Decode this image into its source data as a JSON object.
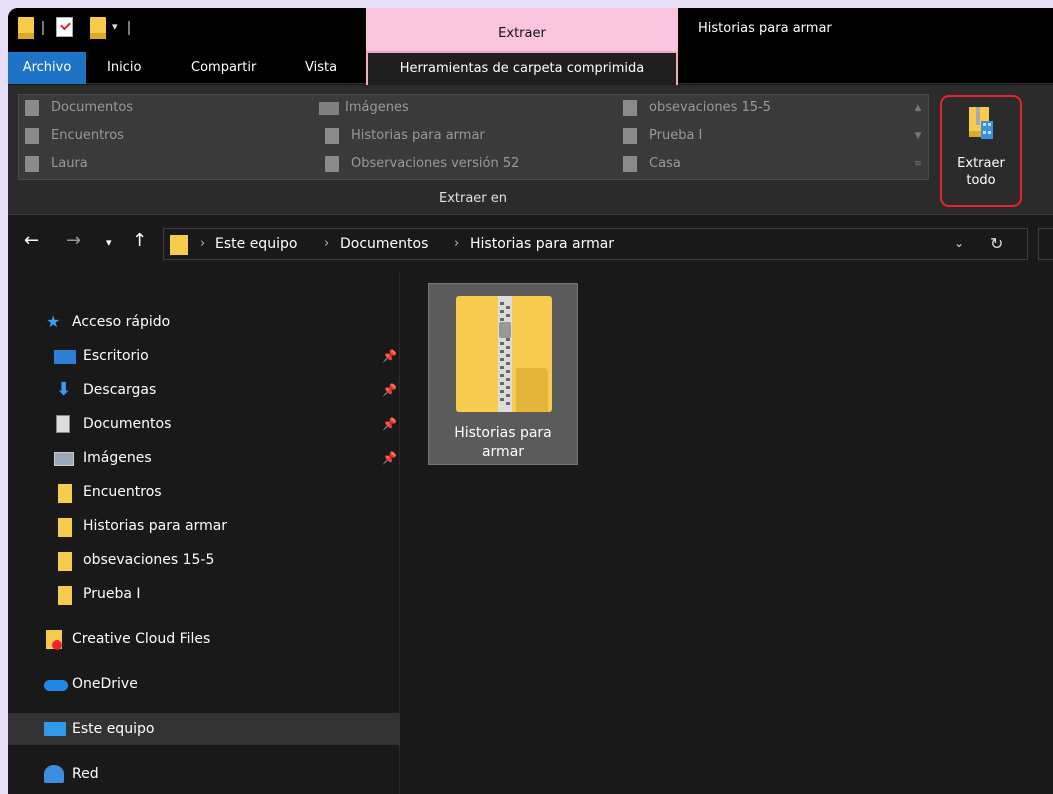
{
  "window": {
    "title": "Historias para armar",
    "context_tab_header": "Extraer"
  },
  "tabs": {
    "archivo": "Archivo",
    "inicio": "Inicio",
    "compartir": "Compartir",
    "vista": "Vista",
    "herramientas": "Herramientas de carpeta comprimida"
  },
  "ribbon": {
    "gallery": [
      {
        "label": "Documentos",
        "icon": "document-icon"
      },
      {
        "label": "Encuentros",
        "icon": "folder-icon"
      },
      {
        "label": "Laura",
        "icon": "folder-icon"
      },
      {
        "label": "Imágenes",
        "icon": "pictures-icon"
      },
      {
        "label": "Historias para armar",
        "icon": "folder-icon"
      },
      {
        "label": "Observaciones versión 52",
        "icon": "folder-icon"
      },
      {
        "label": "obsevaciones 15-5",
        "icon": "folder-icon"
      },
      {
        "label": "Prueba I",
        "icon": "folder-icon"
      },
      {
        "label": "Casa",
        "icon": "folder-icon"
      }
    ],
    "group_label": "Extraer en",
    "extract_all_label": "Extraer\ntodo",
    "highlight_color": "#e8242c"
  },
  "address": {
    "crumbs": [
      "Este equipo",
      "Documentos",
      "Historias para armar"
    ]
  },
  "sidebar": {
    "quick_access": "Acceso rápido",
    "items": [
      {
        "label": "Escritorio",
        "pinned": true
      },
      {
        "label": "Descargas",
        "pinned": true
      },
      {
        "label": "Documentos",
        "pinned": true
      },
      {
        "label": "Imágenes",
        "pinned": true
      },
      {
        "label": "Encuentros"
      },
      {
        "label": "Historias para armar"
      },
      {
        "label": "obsevaciones 15-5"
      },
      {
        "label": "Prueba I"
      }
    ],
    "creative_cloud": "Creative Cloud Files",
    "onedrive": "OneDrive",
    "this_pc": "Este equipo",
    "network": "Red"
  },
  "content": {
    "item_label": "Historias para\narmar"
  },
  "colors": {
    "accent": "#1d73c6",
    "context_tab": "#f9c5dc",
    "folder": "#f7cb4d"
  }
}
